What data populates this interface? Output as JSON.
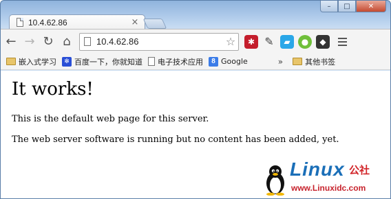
{
  "tab": {
    "title": "10.4.62.86"
  },
  "window_controls": {
    "minimize": "–",
    "maximize": "□",
    "close": "✕"
  },
  "toolbar": {
    "back_icon": "←",
    "forward_icon": "→",
    "reload_icon": "↻",
    "home_icon": "⌂",
    "url": "10.4.62.86",
    "star_icon": "☆"
  },
  "extensions": [
    "lastpass-icon",
    "pen-icon",
    "note-icon",
    "owl-icon",
    "evernote-icon"
  ],
  "bookmarks": {
    "items": [
      {
        "label": "嵌入式学习",
        "icon": "folder-icon"
      },
      {
        "label": "百度一下，你就知道",
        "icon": "baidu-icon"
      },
      {
        "label": "电子技术应用",
        "icon": "page-icon"
      },
      {
        "label": "Google",
        "icon": "google-icon"
      }
    ],
    "overflow": "»",
    "other": "其他书签"
  },
  "page": {
    "heading": "It works!",
    "para1": "This is the default web page for this server.",
    "para2": "The web server software is running but no content has been added, yet."
  },
  "watermark": {
    "brand": "Linux",
    "brand_cn": "公社",
    "url": "www.Linuxidc.com"
  },
  "colors": {
    "accent": "#1b6fb8",
    "watermark_red": "#d2262a"
  }
}
